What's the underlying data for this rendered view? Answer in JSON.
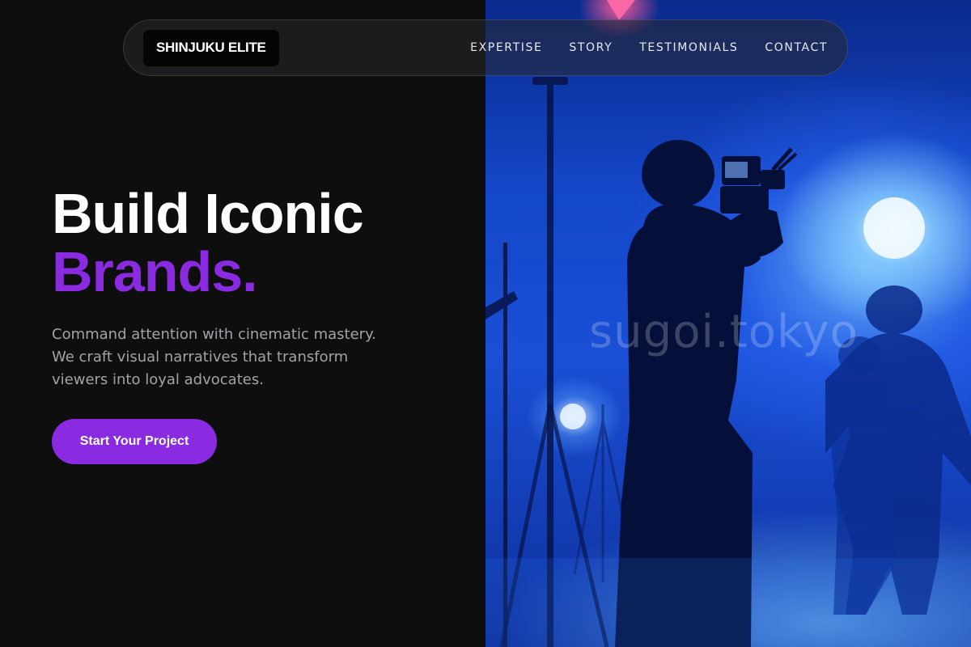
{
  "brand": {
    "logo_text": "SHINJUKU ELITE"
  },
  "nav": {
    "links": [
      {
        "label": "EXPERTISE"
      },
      {
        "label": "STORY"
      },
      {
        "label": "TESTIMONIALS"
      },
      {
        "label": "CONTACT"
      }
    ]
  },
  "hero": {
    "headline_line1": "Build Iconic",
    "headline_line2": "Brands.",
    "subtitle": "Command attention with cinematic mastery. We craft visual narratives that transform viewers into loyal advocates.",
    "cta_label": "Start Your Project"
  },
  "media": {
    "watermark": "sugoi.tokyo",
    "image_subject": "silhouette of camera operator filming dancers on blue-lit stage"
  },
  "colors": {
    "background": "#0e0e0f",
    "accent": "#8a2be2",
    "subtitle_text": "#a2a2a8",
    "stage_blue": "#1a4fd6"
  }
}
